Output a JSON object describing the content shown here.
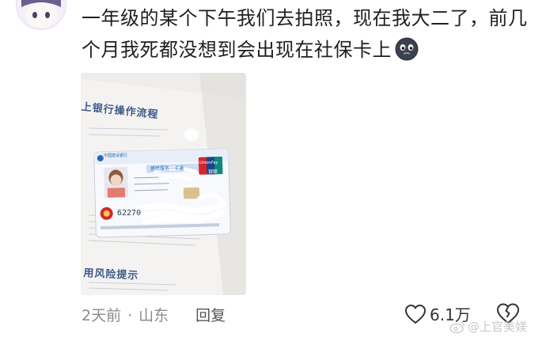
{
  "comment": {
    "text": "一年级的某个下午我们去拍照，现在我大二了，前几个月我死都没想到会出现在社保卡上",
    "emoji": "dark-face-emoji"
  },
  "photo": {
    "flyer_heading_top": "上银行操作流程",
    "flyer_heading_bottom": "用风险提示",
    "card": {
      "bank": "中国建设银行",
      "title": "居民服务一卡通",
      "unionpay": "UnionPay",
      "unionpay_cn": "银联",
      "number_prefix": "62270"
    }
  },
  "meta": {
    "time": "2天前",
    "separator": "·",
    "location": "山东",
    "reply": "回复"
  },
  "like": {
    "count": "6.1万"
  },
  "watermark": {
    "text": "@上官美媄"
  },
  "colors": {
    "text": "#1f1f1f",
    "meta": "#8a8a8a",
    "card_blue": "#2a66b8",
    "unionpay_red": "#d6262b"
  }
}
